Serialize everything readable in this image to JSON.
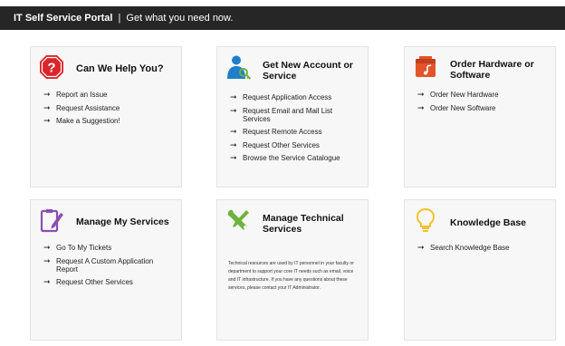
{
  "header": {
    "title": "IT Self Service Portal",
    "separator": "|",
    "tagline": "Get what you need now."
  },
  "cards": [
    {
      "title": "Can We Help You?",
      "icon": "stop-question-icon",
      "items": [
        "Report an Issue",
        "Request Assistance",
        "Make a Suggestion!"
      ]
    },
    {
      "title": "Get New Account or Service",
      "icon": "user-key-icon",
      "items": [
        "Request Application Access",
        "Request Email and Mail List Services",
        "Request Remote Access",
        "Request Other Services",
        "Browse the Service Catalogue"
      ]
    },
    {
      "title": "Order Hardware or Software",
      "icon": "software-box-icon",
      "items": [
        "Order New Hardware",
        "Order New Software"
      ]
    },
    {
      "title": "Manage My Services",
      "icon": "clipboard-pencil-icon",
      "items": [
        "Go To My Tickets",
        "Request A Custom Application Report",
        "Request Other Services"
      ]
    },
    {
      "title": "Manage Technical Services",
      "icon": "wrench-screwdriver-icon",
      "description": "Technical resources are used by IT personnel in your faculty or department to support your core IT needs such as email, voice and IT infrastructure. If you have any questions about these services, please contact your IT Administrator.",
      "items": []
    },
    {
      "title": "Knowledge Base",
      "icon": "lightbulb-icon",
      "items": [
        "Search Knowledge Base"
      ]
    }
  ],
  "colors": {
    "header_bg": "#262626",
    "card_bg": "#f7f7f7",
    "help_red": "#d9262c",
    "account_blue": "#1f7fc9",
    "hardware_orange": "#e2542a",
    "services_purple": "#8a4fb3",
    "technical_green": "#6db33f",
    "knowledge_yellow": "#f2c230"
  }
}
